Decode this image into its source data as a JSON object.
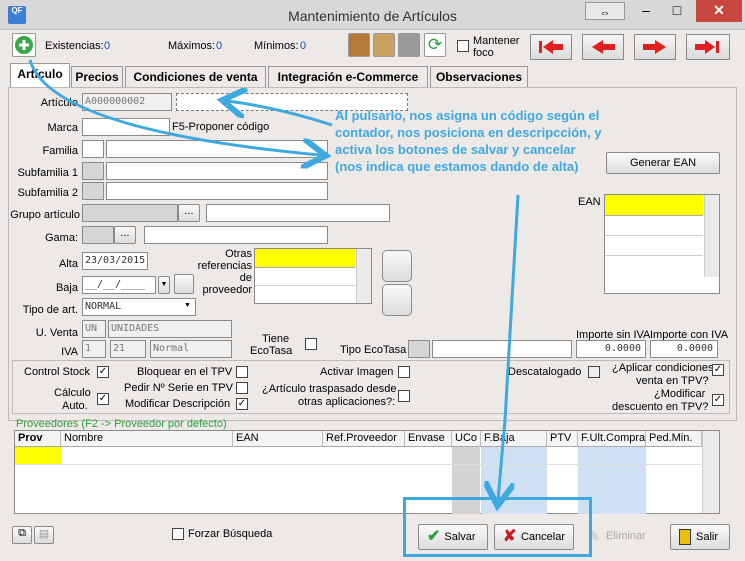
{
  "window": {
    "title": "Mantenimiento de Artículos",
    "app_icon_text": "QF"
  },
  "toolbar": {
    "existencias_label": "Existencias:",
    "existencias_value": "0",
    "maximos_label": "Máximos:",
    "maximos_value": "0",
    "minimos_label": "Mínimos:",
    "minimos_value": "0",
    "mantener_foco_line1": "Mantener",
    "mantener_foco_line2": "foco"
  },
  "tabs": [
    {
      "label": "Artículo"
    },
    {
      "label": "Precios"
    },
    {
      "label": "Condiciones de venta"
    },
    {
      "label": "Integración e-Commerce"
    },
    {
      "label": "Observaciones"
    }
  ],
  "form": {
    "articulo_label": "Artículo",
    "articulo_value": "A000000002",
    "marca_label": "Marca",
    "f5_hint": "F5-Proponer código",
    "familia_label": "Familia",
    "subfamilia1_label": "Subfamilia 1",
    "subfamilia2_label": "Subfamilia 2",
    "grupo_label": "Grupo artículo",
    "ellipsis": "...",
    "gama_label": "Gama:",
    "alta_label": "Alta",
    "alta_value": "23/03/2015",
    "baja_label": "Baja",
    "baja_value": "__/__/____",
    "tipo_label": "Tipo de art.",
    "tipo_value": "NORMAL",
    "uventa_label": "U. Venta",
    "uventa_code": "UN",
    "uventa_desc": "UNIDADES",
    "iva_label": "IVA",
    "iva_code": "1",
    "iva_pct": "21",
    "iva_desc": "Normal",
    "otras_ref_label": "Otras referencias de proveedor",
    "ecotasa_label_line1": "Tiene",
    "ecotasa_label_line2": "EcoTasa",
    "tipo_ecotasa_label": "Tipo EcoTasa",
    "importe_sin_iva_label": "Importe sin IVA",
    "importe_sin_iva_value": "0.0000",
    "importe_con_iva_label": "Importe con IVA",
    "importe_con_iva_value": "0.0000",
    "generar_ean_label": "Generar EAN",
    "ean_label": "EAN"
  },
  "checks": {
    "control_stock": "Control Stock",
    "calculo_auto_line1": "Cálculo",
    "calculo_auto_line2": "Auto.",
    "bloquear_tpv": "Bloquear en el TPV",
    "pedir_serie": "Pedir Nº Serie en TPV",
    "modificar_desc": "Modificar Descripción",
    "activar_imagen": "Activar Imagen",
    "traspasado_line1": "¿Artículo traspasado desde",
    "traspasado_line2": "otras aplicaciones?:",
    "descatalogado": "Descatalogado",
    "aplicar_cond_line1": "¿Aplicar condiciones",
    "aplicar_cond_line2": "venta en TPV?",
    "modificar_dto_line1": "¿Modificar",
    "modificar_dto_line2": "descuento en TPV?"
  },
  "proveedores": {
    "title": "Proveedores (F2 -> Proveedor por defecto)",
    "columns": [
      "Prov",
      "Nombre",
      "EAN",
      "Ref.Proveedor",
      "Envase",
      "UCo",
      "F.Baja",
      "PTV",
      "F.Ult.Compra",
      "Ped.Min."
    ]
  },
  "bottom": {
    "forzar_busqueda": "Forzar Búsqueda",
    "salvar": "Salvar",
    "cancelar": "Cancelar",
    "eliminar": "Eliminar",
    "salir": "Salir"
  },
  "annotation": {
    "text": "Al pulsarlo, nos asigna un código según el contador, nos posiciona en descripcción, y activa los botones de salvar y cancelar (nos indica que estamos dando de alta)",
    "color": "#3fa9df"
  },
  "colors": {
    "accent_yellow": "#ffff00",
    "nav_red": "#e02020",
    "label_blue": "#1a46c8"
  }
}
